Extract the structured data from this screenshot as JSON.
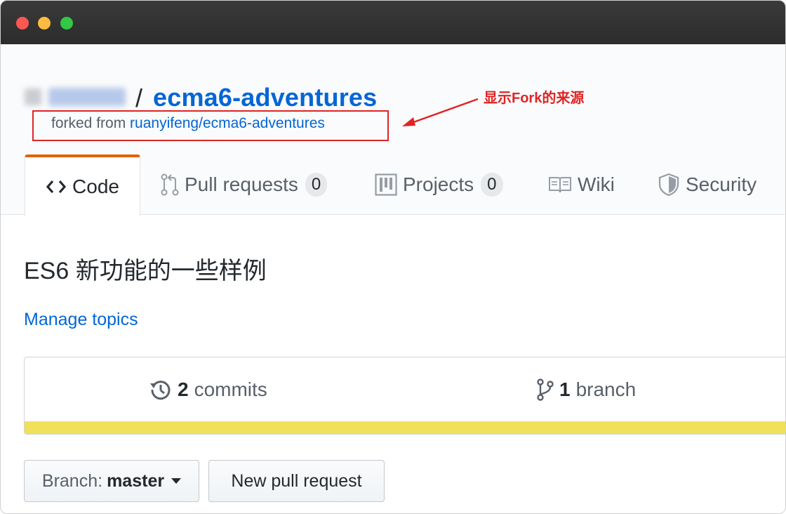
{
  "window": {
    "traffic_lights": [
      "close",
      "minimize",
      "maximize"
    ]
  },
  "repo": {
    "separator": "/",
    "name": "ecma6-adventures",
    "forked_prefix": "forked from ",
    "forked_source": "ruanyifeng/ecma6-adventures"
  },
  "annotation": {
    "text": "显示Fork的来源",
    "color": "#e02424"
  },
  "tabs": [
    {
      "label": "Code",
      "icon": "code-icon",
      "selected": true
    },
    {
      "label": "Pull requests",
      "icon": "pull-request-icon",
      "count": "0"
    },
    {
      "label": "Projects",
      "icon": "project-icon",
      "count": "0"
    },
    {
      "label": "Wiki",
      "icon": "book-icon"
    },
    {
      "label": "Security",
      "icon": "shield-icon"
    }
  ],
  "description": "ES6 新功能的一些样例",
  "manage_topics": "Manage topics",
  "summary": {
    "commits_count": "2",
    "commits_label": "commits",
    "branch_count": "1",
    "branch_label": "branch",
    "language_bar_color": "#f1e05a"
  },
  "buttons": {
    "branch_prefix": "Branch:",
    "branch_value": "master",
    "new_pull_request": "New pull request"
  },
  "colors": {
    "link": "#0366d6",
    "tab_accent": "#e36209"
  }
}
